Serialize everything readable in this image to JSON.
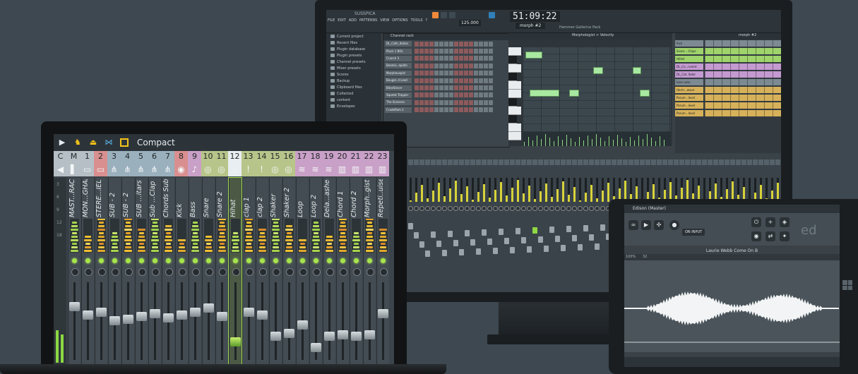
{
  "monitor": {
    "window_title": "SUSSPICA",
    "menu": [
      "FILE",
      "EDIT",
      "ADD",
      "PATTERNS",
      "VIEW",
      "OPTIONS",
      "TOOLS",
      "?"
    ],
    "time": "51:09:22",
    "tempo": "125.000",
    "pattern": "morph #2",
    "pack": "Hammer Gallerice Pack",
    "browser_items": [
      "Current project",
      "Recent files",
      "Plugin database",
      "Plugin presets",
      "Channel presets",
      "Mixer presets",
      "Scores",
      "Backup",
      "Clipboard files",
      "Collected",
      "content",
      "Envelopes"
    ],
    "channel_rack_title": "Channel rack",
    "rack_channels": [
      "DL_Cath_Italian",
      "Pluck 1 BOL",
      "Crunch 3",
      "Beamic..epidm",
      "Morpheuspist",
      "Beugal..d Lead",
      "BlineSincer",
      "Squeek Trapper",
      "The Sickness",
      "Crudeflam 2"
    ],
    "piano_roll_title": "Morphologist > Velocity",
    "playlist_title": "morph #2",
    "playlist_tracks": [
      {
        "name": "Kick",
        "color": "#7d8a92"
      },
      {
        "name": "Snare ...Claps",
        "color": "#9fd36b"
      },
      {
        "name": "HiHat",
        "color": "#9fd36b"
      },
      {
        "name": "DL_Co...rumnt",
        "color": "#c49ad0"
      },
      {
        "name": "DL_Cat..ltaler",
        "color": "#c49ad0"
      },
      {
        "name": "bass auto",
        "color": "#7d8a92"
      },
      {
        "name": "Harm...wave",
        "color": "#d6b15a"
      },
      {
        "name": "Parum ..level",
        "color": "#d6b15a"
      },
      {
        "name": "Parum ..level",
        "color": "#d6b15a"
      },
      {
        "name": "Parum ..level",
        "color": "#d6b15a"
      }
    ]
  },
  "laptop_mixer": {
    "toolbar_label": "Compact",
    "scale_labels": [
      "3",
      "6",
      "9",
      "12",
      "18"
    ],
    "strips": [
      {
        "num": "C",
        "name": "",
        "num_color": "#b5bfc5",
        "icon": "◀",
        "fader": 0.0
      },
      {
        "num": "M",
        "name": "MAST...RACK",
        "num_color": "#b5bfc5",
        "icon": "▌",
        "fader": 0.72
      },
      {
        "num": "1",
        "name": "MON...GHAL",
        "num_color": "#b5bfc5",
        "icon": "▭",
        "fader": 0.6
      },
      {
        "num": "2",
        "name": "STERE...IELD",
        "num_color": "#d98f8f",
        "icon": "▭",
        "fader": 0.64
      },
      {
        "num": "3",
        "name": "SUB - 2",
        "num_color": "#9ab0bd",
        "icon": "⋔",
        "fader": 0.52
      },
      {
        "num": "4",
        "name": "SUB - 2",
        "num_color": "#9ab0bd",
        "icon": "⋔",
        "fader": 0.54
      },
      {
        "num": "5",
        "name": "SUB ...itars",
        "num_color": "#9ab0bd",
        "icon": "⋔",
        "fader": 0.58
      },
      {
        "num": "6",
        "name": "Sub ...Clap",
        "num_color": "#9ab0bd",
        "icon": "⋔",
        "fader": 0.62
      },
      {
        "num": "7",
        "name": "Chords Sub",
        "num_color": "#9ab0bd",
        "icon": "⋔",
        "fader": 0.56
      },
      {
        "num": "8",
        "name": "Kick",
        "num_color": "#d98f8f",
        "icon": "◉",
        "fader": 0.6
      },
      {
        "num": "9",
        "name": "Bass",
        "num_color": "#c9a0c7",
        "icon": "♪",
        "fader": 0.64
      },
      {
        "num": "10",
        "name": "Snare",
        "num_color": "#b7c58a",
        "icon": "◎",
        "fader": 0.7
      },
      {
        "num": "11",
        "name": "Snare 2",
        "num_color": "#b7c58a",
        "icon": "◎",
        "fader": 0.58
      },
      {
        "num": "12",
        "name": "Hihat",
        "num_color": "#e8eef1",
        "icon": "⊥",
        "fader": 0.22,
        "selected": true
      },
      {
        "num": "13",
        "name": "clap 1",
        "num_color": "#b7c58a",
        "icon": "!",
        "fader": 0.64
      },
      {
        "num": "14",
        "name": "clap 2",
        "num_color": "#b7c58a",
        "icon": "!",
        "fader": 0.6
      },
      {
        "num": "15",
        "name": "Shaker",
        "num_color": "#b7c58a",
        "icon": "◎",
        "fader": 0.3
      },
      {
        "num": "16",
        "name": "Shaker 2",
        "num_color": "#b7c58a",
        "icon": "◎",
        "fader": 0.34
      },
      {
        "num": "17",
        "name": "Loop",
        "num_color": "#c9a0c7",
        "icon": "≋",
        "fader": 0.46
      },
      {
        "num": "18",
        "name": "Loop 2",
        "num_color": "#c9a0c7",
        "icon": "≋",
        "fader": 0.14
      },
      {
        "num": "19",
        "name": "Dela...ashed",
        "num_color": "#c9a0c7",
        "icon": "≋",
        "fader": 0.3
      },
      {
        "num": "20",
        "name": "Chord 1",
        "num_color": "#c9a0c7",
        "icon": "▥",
        "fader": 0.32
      },
      {
        "num": "21",
        "name": "Chord 2",
        "num_color": "#c9a0c7",
        "icon": "▥",
        "fader": 0.3
      },
      {
        "num": "22",
        "name": "Morph..gist",
        "num_color": "#c9a0c7",
        "icon": "▥",
        "fader": 0.32
      },
      {
        "num": "23",
        "name": "Repeti..uise",
        "num_color": "#c9a0c7",
        "icon": "▥",
        "fader": 0.62
      }
    ]
  },
  "tablet": {
    "title": "Edison (Master)",
    "on_input": "ON INPUT",
    "filename": "Laurie Webb Come On B",
    "ruler_left": "100%",
    "ruler_right": "32",
    "big_label": "ed"
  },
  "colors": {
    "accent_green": "#a6e54a",
    "accent_yellow": "#f5c518",
    "background": "#3d4850"
  }
}
